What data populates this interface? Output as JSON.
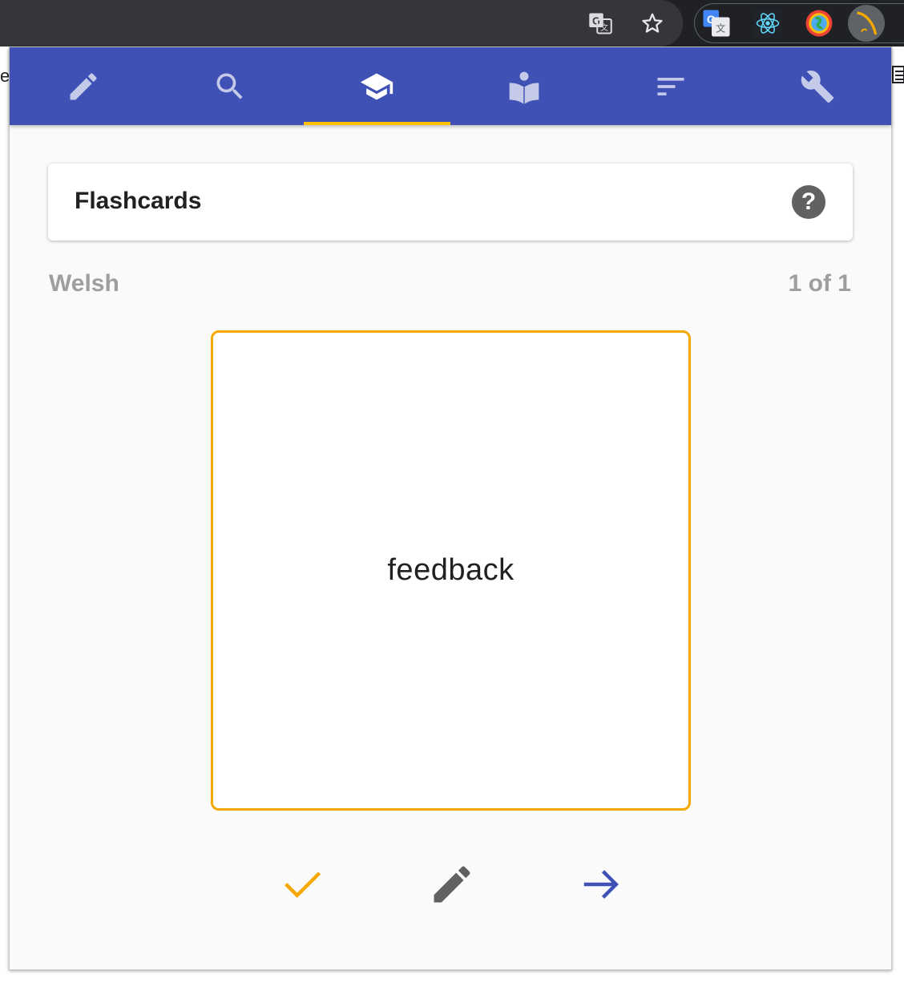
{
  "browser": {
    "page_edge_text": "e",
    "toolbar_icons": [
      "translate-icon",
      "star-bookmark-icon"
    ],
    "extensions": [
      "google-translate-extension-icon",
      "react-devtools-icon",
      "globe-extension-icon",
      "flashcards-extension-icon"
    ]
  },
  "nav": {
    "tabs": [
      {
        "icon": "pencil-icon",
        "active": false
      },
      {
        "icon": "search-icon",
        "active": false
      },
      {
        "icon": "graduation-cap-icon",
        "active": true
      },
      {
        "icon": "reader-book-icon",
        "active": false
      },
      {
        "icon": "sort-lines-icon",
        "active": false
      },
      {
        "icon": "wrench-icon",
        "active": false
      }
    ],
    "background": "#3f51b5",
    "indicator_color": "#ffc107"
  },
  "header": {
    "title": "Flashcards",
    "help_symbol": "?"
  },
  "deck": {
    "language": "Welsh",
    "counter": "1 of 1"
  },
  "card": {
    "word": "feedback",
    "border_color": "#f5a800"
  },
  "actions": [
    {
      "name": "mark-known",
      "icon": "check-icon",
      "color": "#f5a800"
    },
    {
      "name": "edit",
      "icon": "pencil-icon",
      "color": "#616161"
    },
    {
      "name": "next",
      "icon": "arrow-right-icon",
      "color": "#3f51b5"
    }
  ]
}
